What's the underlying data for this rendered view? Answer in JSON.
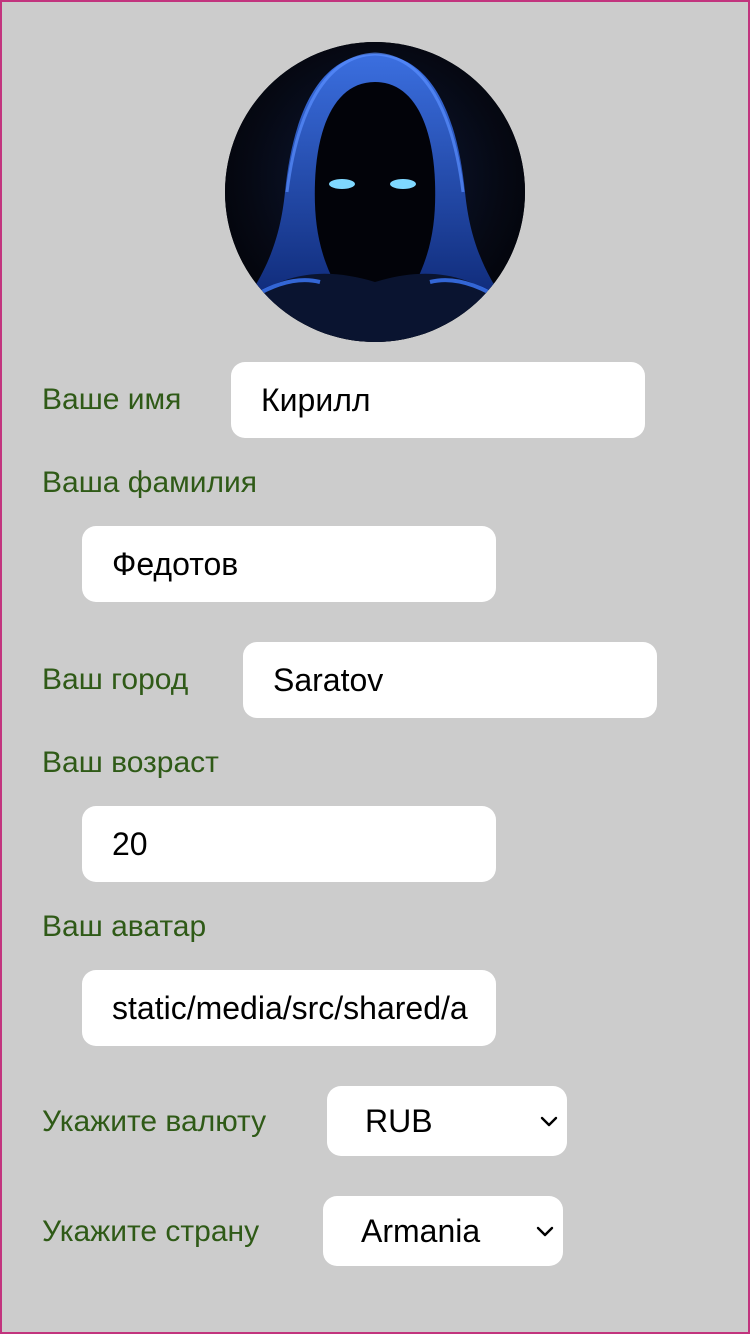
{
  "profile": {
    "avatar_icon": "hooded-figure-avatar",
    "first_name": {
      "label": "Ваше имя",
      "value": "Кирилл"
    },
    "last_name": {
      "label": "Ваша фамилия",
      "value": "Федотов"
    },
    "city": {
      "label": "Ваш город",
      "value": "Saratov"
    },
    "age": {
      "label": "Ваш возраст",
      "value": "20"
    },
    "avatar_field": {
      "label": "Ваш аватар",
      "value": "static/media/src/shared/a"
    },
    "currency": {
      "label": "Укажите валюту",
      "value": "RUB"
    },
    "country": {
      "label": "Укажите страну",
      "value": "Armania"
    }
  },
  "colors": {
    "background": "#cccccc",
    "frame_border": "#c2347e",
    "label_text": "#2f5a17",
    "field_background": "#ffffff"
  }
}
